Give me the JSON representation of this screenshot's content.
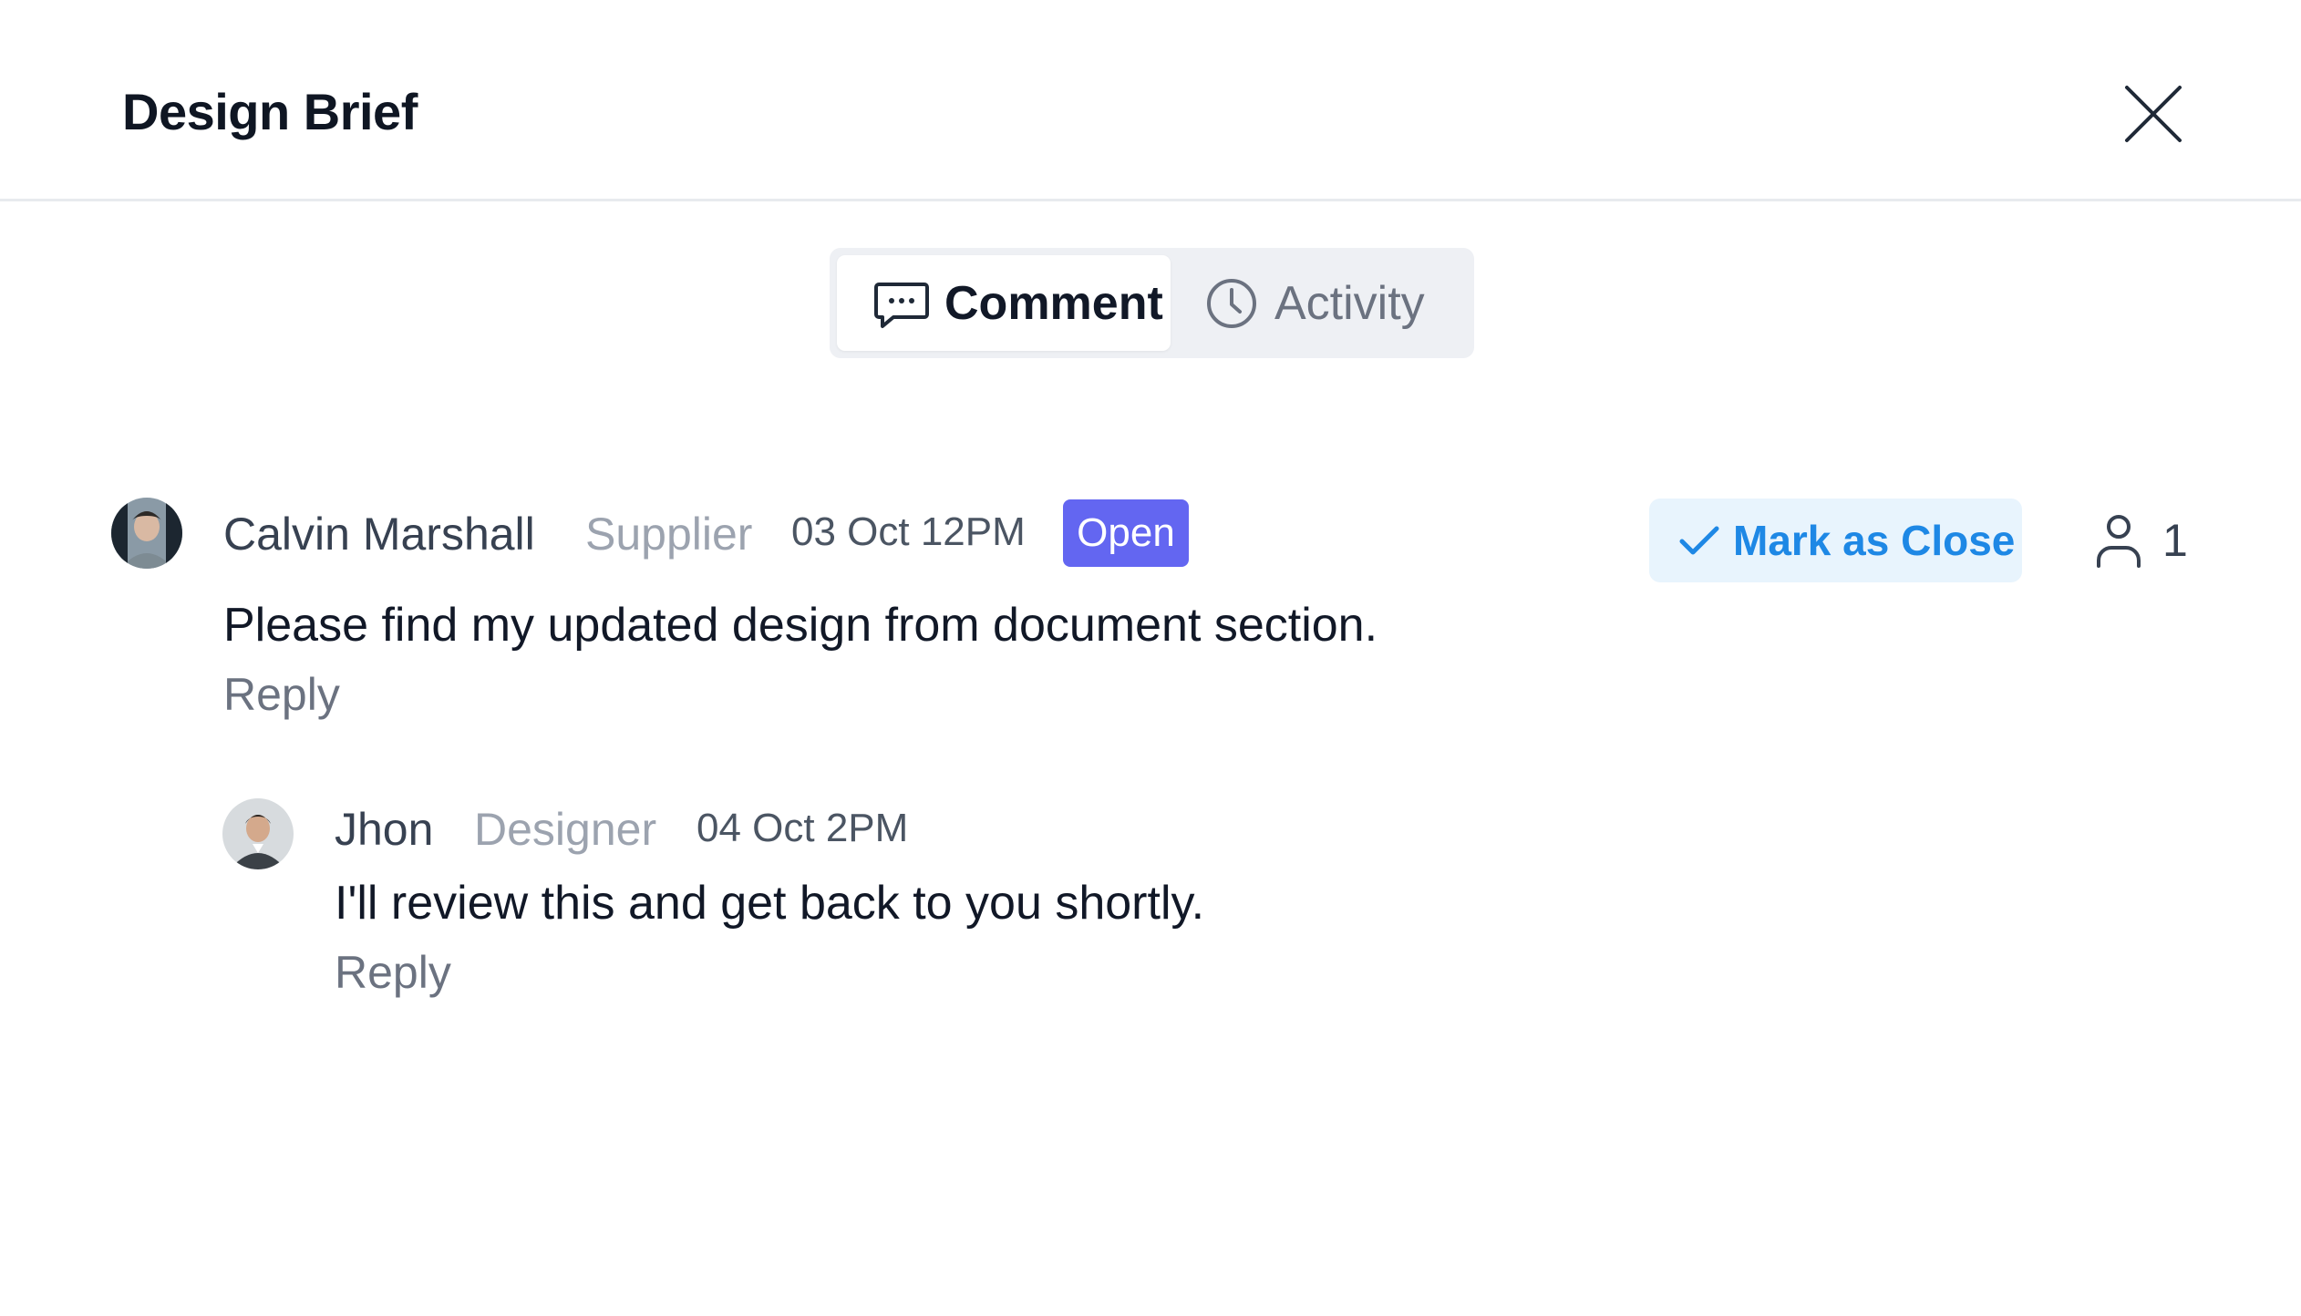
{
  "header": {
    "title": "Design Brief",
    "close_icon": "close-icon"
  },
  "tabs": [
    {
      "label": "Comment",
      "icon": "comment-icon",
      "active": true
    },
    {
      "label": "Activity",
      "icon": "clock-icon",
      "active": false
    }
  ],
  "comments": [
    {
      "author": "Calvin Marshall",
      "role": "Supplier",
      "time": "03 Oct 12PM",
      "status": "Open",
      "text": "Please find my updated design from document section.",
      "reply_label": "Reply",
      "action_label": "Mark as Close",
      "assignee_count": "1"
    },
    {
      "author": "Jhon",
      "role": "Designer",
      "time": "04 Oct 2PM",
      "text": "I'll review this and get back to you shortly.",
      "reply_label": "Reply"
    }
  ],
  "colors": {
    "status_badge": "#6366f1",
    "action_bg": "#e8f4fd",
    "action_text": "#1e88e5",
    "divider": "#e8eaee",
    "tabs_bg": "#eef0f4"
  }
}
